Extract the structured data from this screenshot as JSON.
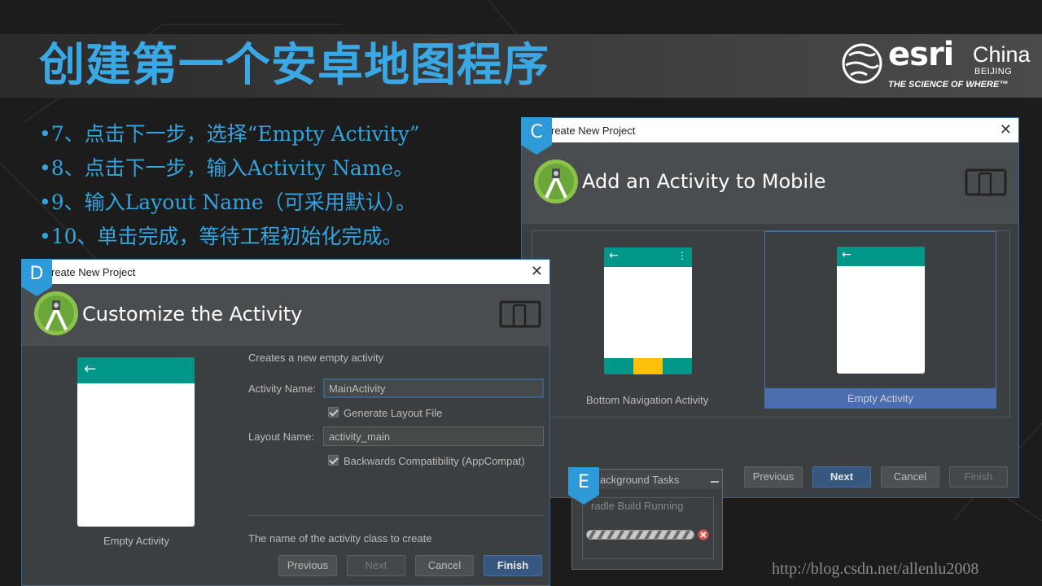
{
  "slide": {
    "title": "创建第一个安卓地图程序",
    "bullets": [
      "•7、点击下一步，选择“Empty Activity”",
      "•8、点击下一步，输入Activity Name。",
      "•9、输入Layout Name（可采用默认）。",
      "•10、单击完成，等待工程初始化完成。"
    ],
    "watermark": "http://blog.csdn.net/allenlu2008"
  },
  "logo": {
    "word": "esri",
    "region": "China",
    "city": "BEIJING",
    "tagline": "THE SCIENCE OF WHERE™"
  },
  "dialog_c": {
    "badge": "C",
    "window_title": "reate New Project",
    "header": "Add an Activity to Mobile",
    "templates": [
      {
        "label": "Bottom Navigation Activity"
      },
      {
        "label": "Empty Activity",
        "selected": true
      }
    ],
    "buttons": {
      "previous": "Previous",
      "next": "Next",
      "cancel": "Cancel",
      "finish": "Finish"
    }
  },
  "dialog_d": {
    "badge": "D",
    "window_title": "reate New Project",
    "header": "Customize the Activity",
    "preview_label": "Empty Activity",
    "description": "Creates a new empty activity",
    "activity_name_label": "Activity Name:",
    "activity_name_value": "MainActivity",
    "generate_layout_label": "Generate Layout File",
    "generate_layout_checked": true,
    "layout_name_label": "Layout Name:",
    "layout_name_value": "activity_main",
    "backwards_label": "Backwards Compatibility (AppCompat)",
    "backwards_checked": true,
    "hint": "The name of the activity class to create",
    "buttons": {
      "previous": "Previous",
      "next": "Next",
      "cancel": "Cancel",
      "finish": "Finish"
    }
  },
  "dialog_e": {
    "badge": "E",
    "window_title": "ackground Tasks",
    "task_label": "radle Build Running"
  },
  "colors": {
    "accent_blue": "#35a3dd",
    "teal": "#009688",
    "amber": "#ffc107",
    "selected_bg": "#4b6eaf"
  },
  "icons": {
    "close": "close-icon",
    "android_studio": "android-studio-icon",
    "device": "device-icon",
    "back_arrow": "back-arrow-icon",
    "menu_dots": "overflow-menu-icon",
    "cancel_task": "cancel-task-icon",
    "minimize": "minimize-icon"
  }
}
